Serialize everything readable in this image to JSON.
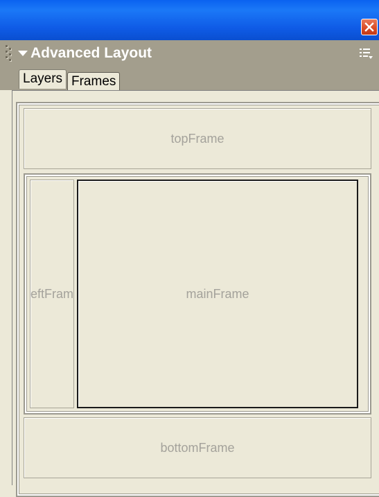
{
  "panel": {
    "title": "Advanced Layout",
    "close_icon": "close-icon",
    "options_icon": "options-menu-icon",
    "collapse_icon": "collapse-arrow-icon"
  },
  "tabs": [
    {
      "label": "Layers",
      "selected": false
    },
    {
      "label": "Frames",
      "selected": true
    }
  ],
  "frames": {
    "top": "topFrame",
    "left": "eftFram",
    "main": "mainFrame",
    "bottom": "bottomFrame"
  },
  "colors": {
    "titlebar": "#0A62F0",
    "panel_header": "#A39E8D",
    "background": "#ECE9D8",
    "selected_frame_border": "#1A1A1A",
    "frame_label": "#A4A29B"
  }
}
